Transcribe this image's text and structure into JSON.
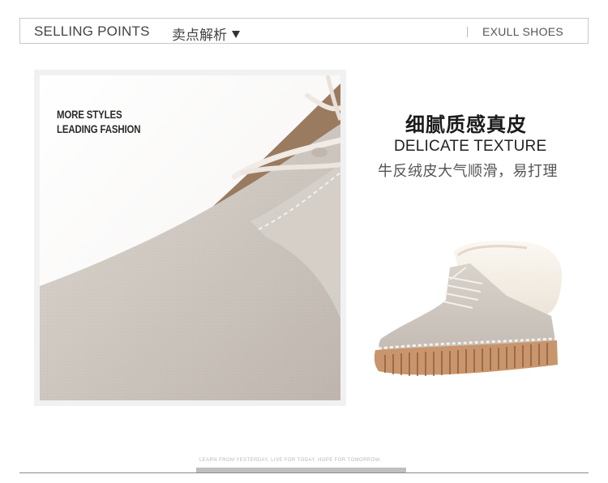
{
  "header": {
    "title_en": "SELLING POINTS",
    "title_cn": "卖点解析",
    "brand": "EXULL SHOES"
  },
  "photo": {
    "caption_line1": "MORE STYLES",
    "caption_line2": "LEADING FASHION"
  },
  "feature": {
    "title_cn": "细腻质感真皮",
    "title_en": "DELICATE TEXTURE",
    "description": "牛反绒皮大气顺滑，易打理"
  },
  "footer": {
    "slogan": "LEARN FROM YESTERDAY, LIVE FOR TODAY, HOPE FOR TOMORROW."
  },
  "colors": {
    "suede": "#cfc8c1",
    "sole": "#c4926a",
    "fur": "#f3ede4",
    "stitch": "#f8f4ee"
  },
  "icons": {
    "dropdown": "triangle-down-icon"
  }
}
